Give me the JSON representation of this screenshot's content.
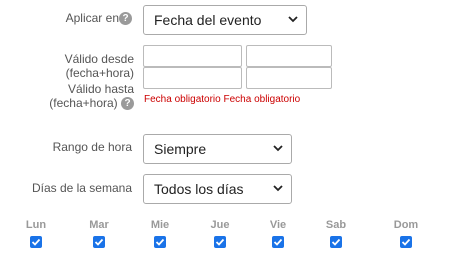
{
  "aplicar_en": {
    "label": "Aplicar en",
    "help_icon": "question-mark-icon",
    "value": "Fecha del evento"
  },
  "valido_desde": {
    "label_line1": "Válido desde",
    "label_line2": "(fecha+hora)"
  },
  "valido_hasta": {
    "label_line1": "Válido hasta",
    "label_line2": "(fecha+hora)",
    "help_icon": "question-mark-icon"
  },
  "validation": {
    "date_error": "Fecha obligatorio",
    "time_error": "Fecha obligatorio",
    "color": "#cc0000"
  },
  "rango_de_hora": {
    "label": "Rango de hora",
    "value": "Siempre"
  },
  "dias_de_la_semana": {
    "label": "Días de la semana",
    "value": "Todos los días"
  },
  "days": [
    {
      "label": "Lun",
      "checked": true
    },
    {
      "label": "Mar",
      "checked": true
    },
    {
      "label": "Mie",
      "checked": true
    },
    {
      "label": "Jue",
      "checked": true
    },
    {
      "label": "Vie",
      "checked": true
    },
    {
      "label": "Sab",
      "checked": true
    },
    {
      "label": "Dom",
      "checked": true
    }
  ],
  "colors": {
    "checkbox": "#1a73e8",
    "error": "#cc0000"
  }
}
